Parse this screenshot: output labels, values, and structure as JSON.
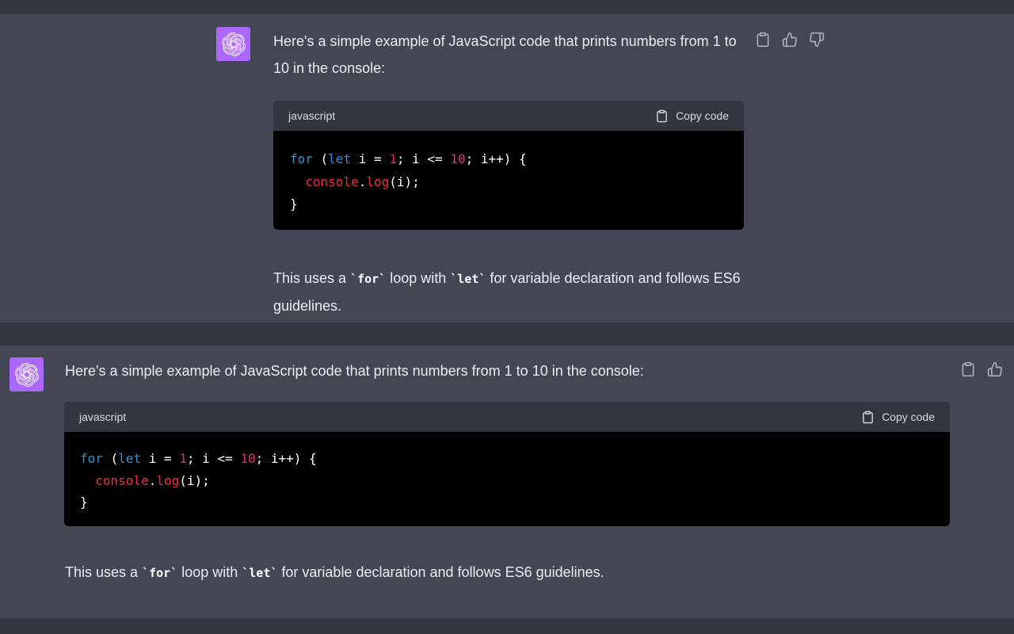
{
  "messages": [
    {
      "intro": "Here's a simple example of JavaScript code that prints numbers from 1 to 10 in the console:",
      "code": {
        "language": "javascript",
        "copy_label": "Copy code",
        "lines": [
          [
            "for",
            " (",
            "let",
            " i = ",
            "1",
            "; i <= ",
            "10",
            "; i++) {"
          ],
          [
            "  ",
            "console",
            ".",
            "log",
            "(i);"
          ],
          [
            "}"
          ]
        ]
      },
      "outro_pre": "This uses a ",
      "outro_code1": "`for`",
      "outro_mid": " loop with ",
      "outro_code2": "`let`",
      "outro_post": " for variable declaration and follows ES6 guidelines."
    },
    {
      "intro": "Here's a simple example of JavaScript code that prints numbers from 1 to 10 in the console:",
      "code": {
        "language": "javascript",
        "copy_label": "Copy code"
      },
      "outro_pre": "This uses a ",
      "outro_code1": "`for`",
      "outro_mid": " loop with ",
      "outro_code2": "`let`",
      "outro_post": " for variable declaration and follows ES6 guidelines."
    }
  ],
  "code_text": {
    "l1_for": "for",
    "l1_a": " (",
    "l1_let": "let",
    "l1_b": " i = ",
    "l1_n1": "1",
    "l1_c": "; i <= ",
    "l1_n2": "10",
    "l1_d": "; i++) {",
    "l2_indent": "  ",
    "l2_console": "console",
    "l2_dot": ".",
    "l2_log": "log",
    "l2_rest": "(i);",
    "l3": "}"
  },
  "colors": {
    "background": "#343541",
    "message_background": "#444654",
    "avatar": "#ab68ff",
    "code_background": "#000000",
    "keyword": "#2e95d3",
    "number": "#df3079"
  },
  "icons": {
    "avatar": "openai-logo-icon",
    "copy": "clipboard-icon",
    "like": "thumbs-up-icon",
    "dislike": "thumbs-down-icon"
  }
}
